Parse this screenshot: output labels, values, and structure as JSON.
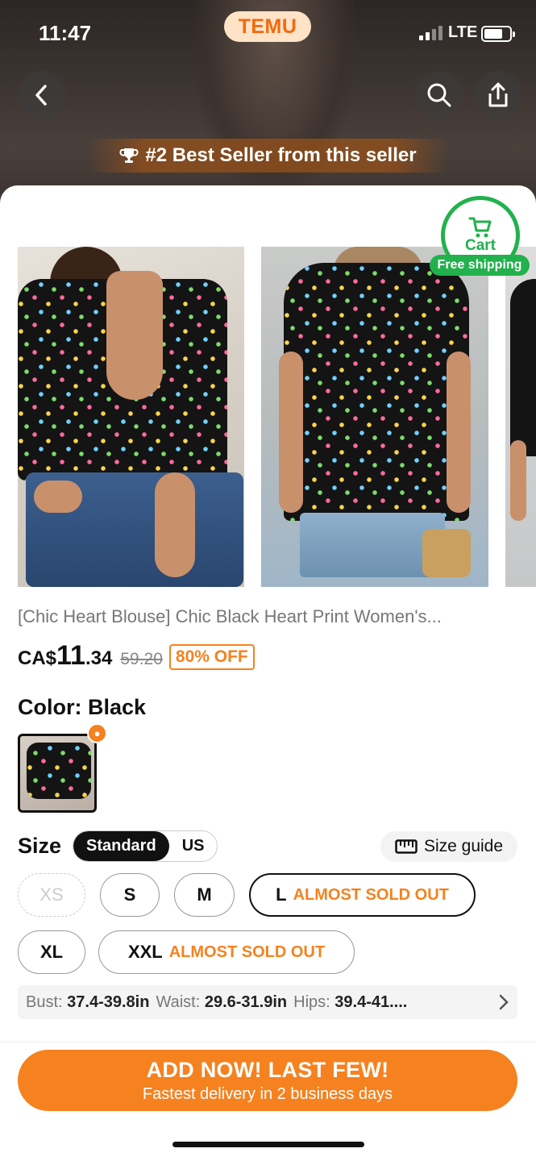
{
  "status_bar": {
    "time": "11:47",
    "network": "LTE"
  },
  "app": {
    "brand": "TEMU"
  },
  "hero": {
    "badge_text": "#2 Best Seller from this seller"
  },
  "cart": {
    "label": "Cart",
    "free_shipping": "Free shipping"
  },
  "product": {
    "title": "[Chic Heart Blouse] Chic Black Heart Print Women's...",
    "currency": "CA$",
    "price_whole": "11",
    "price_cents": ".34",
    "original_price": "59.20",
    "discount": "80% OFF"
  },
  "color": {
    "label": "Color: Black"
  },
  "size": {
    "label": "Size",
    "toggle": [
      "Standard",
      "US"
    ],
    "guide": "Size guide",
    "options": [
      {
        "label": "XS",
        "state": "disabled"
      },
      {
        "label": "S",
        "state": "normal"
      },
      {
        "label": "M",
        "state": "normal"
      },
      {
        "label": "L",
        "note": "ALMOST SOLD OUT",
        "state": "selected"
      },
      {
        "label": "XL",
        "state": "normal"
      },
      {
        "label": "XXL",
        "note": "ALMOST SOLD OUT",
        "state": "normal"
      }
    ]
  },
  "measurements": {
    "bust_label": "Bust:",
    "bust": "37.4-39.8in",
    "waist_label": "Waist:",
    "waist": "29.6-31.9in",
    "hips_label": "Hips:",
    "hips": "39.4-41...."
  },
  "cta": {
    "title": "ADD NOW! LAST FEW!",
    "subtitle": "Fastest delivery in 2 business days"
  },
  "colors": {
    "accent": "#f5821f",
    "green": "#22b14c"
  }
}
